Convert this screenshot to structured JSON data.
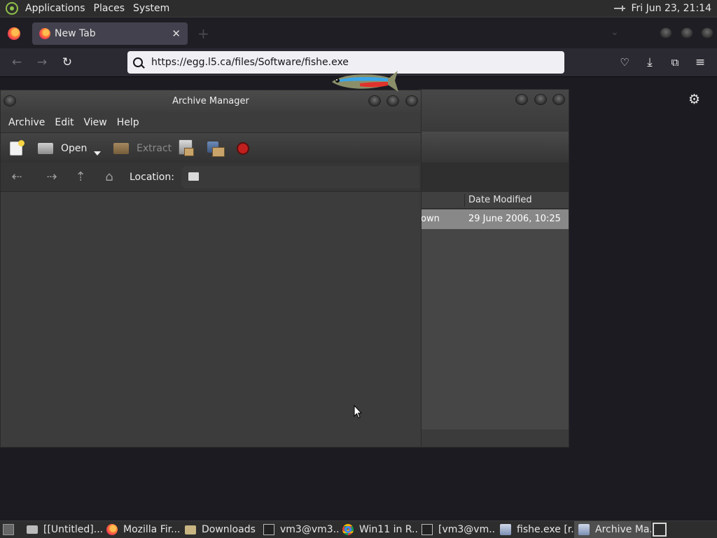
{
  "top_panel": {
    "menus": [
      "Applications",
      "Places",
      "System"
    ],
    "clock": "Fri Jun 23, 21:14"
  },
  "browser": {
    "tab_title": "New Tab",
    "new_tab_symbol": "+",
    "url": "https://egg.l5.ca/files/Software/fishe.exe"
  },
  "archive_manager": {
    "title": "Archive Manager",
    "menus": [
      "Archive",
      "Edit",
      "View",
      "Help"
    ],
    "toolbar": {
      "open_label": "Open",
      "extract_label": "Extract"
    },
    "location_label": "Location:"
  },
  "background_window": {
    "column_header": "Date Modified",
    "row": {
      "type_fragment": "own",
      "date": "29 June 2006, 10:25"
    }
  },
  "taskbar": {
    "items": [
      {
        "label": "[[Untitled]...",
        "icon": "files-icon"
      },
      {
        "label": "Mozilla Fir...",
        "icon": "firefox-icon"
      },
      {
        "label": "Downloads",
        "icon": "folder-icon"
      },
      {
        "label": "vm3@vm3...",
        "icon": "terminal-icon"
      },
      {
        "label": "Win11 in R...",
        "icon": "chrome-icon"
      },
      {
        "label": "[vm3@vm...",
        "icon": "terminal-icon"
      },
      {
        "label": "fishe.exe [r...",
        "icon": "archive-icon"
      },
      {
        "label": "Archive Ma...",
        "icon": "archive-icon"
      }
    ]
  },
  "colors": {
    "accent_firefox": "#ff7139",
    "selection_row": "#888888",
    "stop_button": "#c21f1f"
  }
}
